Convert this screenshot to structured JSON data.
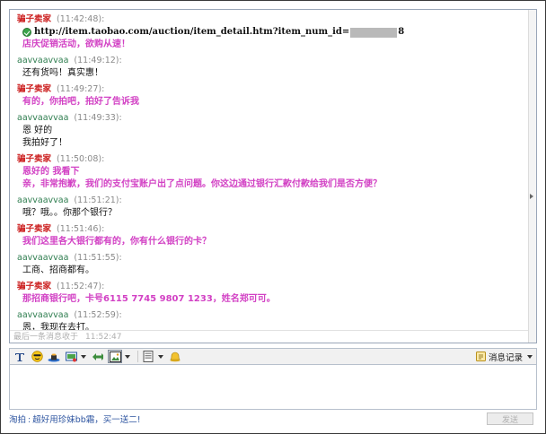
{
  "messages": [
    {
      "sender": "骗子卖家",
      "role": "seller",
      "time": "(11:42:48):",
      "lines": [],
      "link": {
        "prefix": "http://item.taobao.com/auction/item_detail.htm?item_num_id=",
        "suffix": "8"
      },
      "after_link": [
        "店庆促销活动，欲购从速！"
      ]
    },
    {
      "sender": "aavvaavvaa",
      "role": "buyer",
      "time": "(11:49:12):",
      "lines": [
        "还有货吗！真实惠！"
      ]
    },
    {
      "sender": "骗子卖家",
      "role": "seller",
      "time": "(11:49:27):",
      "lines": [
        "有的，你拍吧，拍好了告诉我"
      ]
    },
    {
      "sender": "aavvaavvaa",
      "role": "buyer",
      "time": "(11:49:33):",
      "lines": [
        "恩 好的",
        "我拍好了！"
      ]
    },
    {
      "sender": "骗子卖家",
      "role": "seller",
      "time": "(11:50:08):",
      "lines": [
        "恩好的  我看下",
        "亲，非常抱歉，我们的支付宝账户出了点问题。你这边通过银行汇款付款给我们是否方便？"
      ]
    },
    {
      "sender": "aavvaavvaa",
      "role": "buyer",
      "time": "(11:51:21):",
      "lines": [
        "哦？哦。。你那个银行？"
      ]
    },
    {
      "sender": "骗子卖家",
      "role": "seller",
      "time": "(11:51:46):",
      "lines": [
        "我们这里各大银行都有的，你有什么银行的卡？"
      ]
    },
    {
      "sender": "aavvaavvaa",
      "role": "buyer",
      "time": "(11:51:55):",
      "lines": [
        "工商、招商都有。"
      ]
    },
    {
      "sender": "骗子卖家",
      "role": "seller",
      "time": "(11:52:47):",
      "lines": [
        "那招商银行吧，卡号6115 7745 9807 1233，姓名郑可可。"
      ]
    },
    {
      "sender": "aavvaavvaa",
      "role": "buyer",
      "time": "(11:52:59):",
      "lines": [
        "恩，我现在去打。"
      ]
    }
  ],
  "status": {
    "label": "最后一条消息收于",
    "time": "11:52:47"
  },
  "toolbar": {
    "icons": [
      "font-icon",
      "emoticon-icon",
      "hat-icon",
      "screenshot-icon",
      "send-image-icon",
      "shake-icon",
      "display-icon",
      "bell-icon"
    ],
    "history_label": "消息记录"
  },
  "footer": {
    "ad_prefix": "淘拍",
    "ad_text": "超好用珍妹bb霜，买一送二!",
    "send_label": "发送"
  },
  "colors": {
    "seller": "#cc1f1f",
    "seller_text": "#d241c4",
    "buyer": "#2e7d4f",
    "link_ad": "#2d54a0"
  }
}
